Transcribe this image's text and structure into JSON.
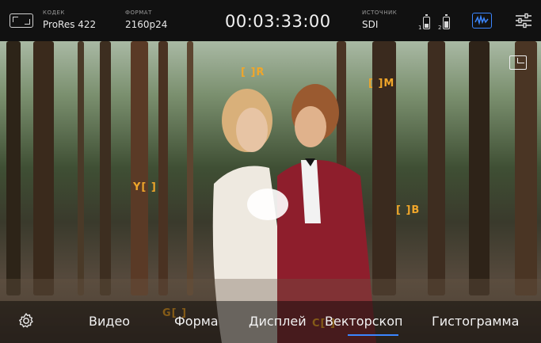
{
  "topbar": {
    "codec_label": "КОДЕК",
    "codec_value": "ProRes 422",
    "format_label": "ФОРМАТ",
    "format_value": "2160p24",
    "timecode": "00:03:33:00",
    "source_label": "ИСТОЧНИК",
    "source_value": "SDI",
    "battery1_label": "1",
    "battery2_label": "2",
    "battery1_level": 0.45,
    "battery2_level": 0.7
  },
  "vectorscope_targets": {
    "r": "[ ]R",
    "m": "[ ]M",
    "y": "Y[ ]",
    "b": "[ ]B",
    "g": "G[ ]",
    "c": "C[ ]"
  },
  "tabs": [
    "Видео",
    "Форма",
    "Дисплей",
    "Векторскоп",
    "Гистограмма"
  ],
  "active_tab": "Векторскоп",
  "icons": {
    "fullscreen": "fullscreen-icon",
    "scope": "waveform-icon",
    "sliders": "sliders-icon",
    "pip": "picture-in-picture-icon",
    "settings": "gear-icon"
  },
  "colors": {
    "accent": "#3b86ff",
    "target": "#f0a62a"
  }
}
